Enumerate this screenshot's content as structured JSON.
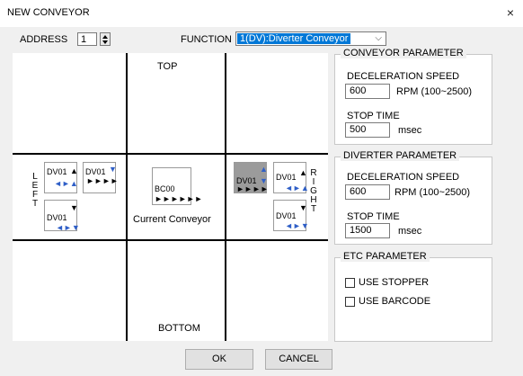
{
  "window": {
    "title": "NEW CONVEYOR",
    "close": "×"
  },
  "address": {
    "label": "ADDRESS",
    "value": "1"
  },
  "function": {
    "label": "FUNCTION",
    "selected": "1(DV):Diverter Conveyor"
  },
  "layout": {
    "top_label": "TOP",
    "bottom_label": "BOTTOM",
    "left_letters": [
      "L",
      "E",
      "F",
      "T"
    ],
    "right_letters": [
      "R",
      "I",
      "G",
      "H",
      "T"
    ],
    "current": {
      "name": "BC00",
      "arrows": "►►►►►►",
      "caption": "Current Conveyor"
    },
    "left_units": [
      {
        "name": "DV01",
        "dir": "▲",
        "arrows": "◄►▲"
      },
      {
        "name": "DV01",
        "dir": "▼",
        "arrows": "►►►►"
      },
      {
        "name": "DV01",
        "dir": "▼",
        "arrows": "◄►▼"
      }
    ],
    "right_units": [
      {
        "name": "DV01",
        "dir": "▼",
        "arrows": "►►►►",
        "highlight": true
      },
      {
        "name": "DV01",
        "dir": "▲",
        "arrows": "◄►▲"
      },
      {
        "name": "DV01",
        "dir": "▼",
        "arrows": "◄►▼"
      }
    ]
  },
  "conveyor_param": {
    "title": "CONVEYOR  PARAMETER",
    "decel_label": "DECELERATION SPEED",
    "decel_value": "600",
    "decel_unit": "RPM (100~2500)",
    "stop_label": "STOP TIME",
    "stop_value": "500",
    "stop_unit": "msec"
  },
  "diverter_param": {
    "title": "DIVERTER  PARAMETER",
    "decel_label": "DECELERATION SPEED",
    "decel_value": "600",
    "decel_unit": "RPM (100~2500)",
    "stop_label": "STOP TIME",
    "stop_value": "1500",
    "stop_unit": "msec"
  },
  "etc_param": {
    "title": "ETC PARAMETER",
    "use_stopper": "USE STOPPER",
    "use_barcode": "USE BARCODE"
  },
  "buttons": {
    "ok": "OK",
    "cancel": "CANCEL"
  }
}
